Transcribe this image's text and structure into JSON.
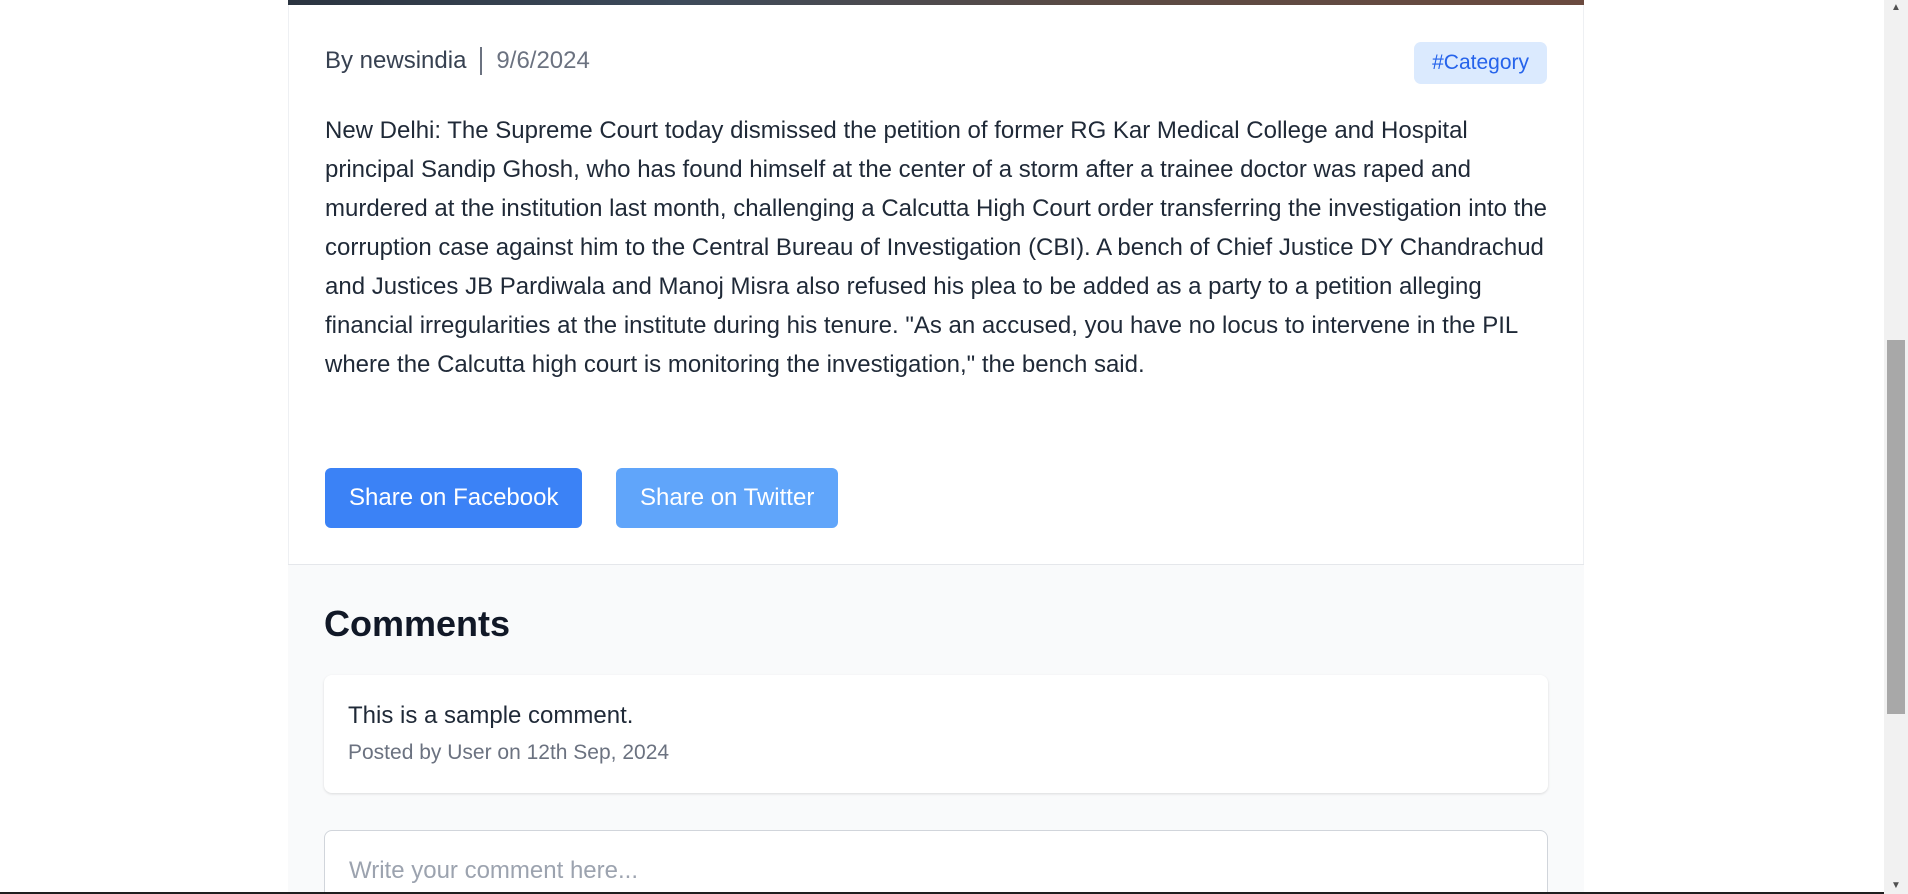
{
  "article": {
    "author_line": "By newsindia",
    "date": "9/6/2024",
    "category": "#Category",
    "body": "New Delhi: The Supreme Court today dismissed the petition of former RG Kar Medical College and Hospital principal Sandip Ghosh, who has found himself at the center of a storm after a trainee doctor was raped and murdered at the institution last month, challenging a Calcutta High Court order transferring the investigation into the corruption case against him to the Central Bureau of Investigation (CBI). A bench of Chief Justice DY Chandrachud and Justices JB Pardiwala and Manoj Misra also refused his plea to be added as a party to a petition alleging financial irregularities at the institute during his tenure. \"As an accused, you have no locus to intervene in the PIL where the Calcutta high court is monitoring the investigation,\" the bench said."
  },
  "share": {
    "facebook_label": "Share on Facebook",
    "twitter_label": "Share on Twitter"
  },
  "comments": {
    "title": "Comments",
    "items": [
      {
        "text": "This is a sample comment.",
        "meta": "Posted by User on 12th Sep, 2024"
      }
    ],
    "input_placeholder": "Write your comment here..."
  },
  "scrollbar": {
    "up_icon": "▲",
    "down_icon": "▼"
  },
  "colors": {
    "facebook_button": "#3b82f6",
    "twitter_button": "#60a5fa",
    "category_badge_bg": "#dbeafe",
    "category_badge_text": "#2563eb"
  }
}
